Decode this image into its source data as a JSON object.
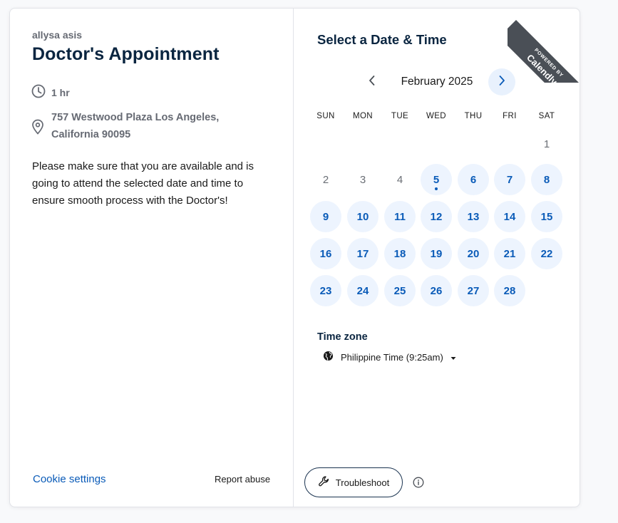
{
  "event": {
    "host": "allysa asis",
    "title": "Doctor's Appointment",
    "duration": "1 hr",
    "location_line1": "757 Westwood Plaza Los Angeles,",
    "location_line2": "California 90095",
    "description": "Please make sure that you are available and is going to attend the selected date and time to ensure smooth process with the Doctor's!",
    "cookie_settings": "Cookie settings",
    "report_abuse": "Report abuse"
  },
  "scheduler": {
    "title": "Select a Date & Time",
    "month_label": "February 2025",
    "weekdays": [
      "SUN",
      "MON",
      "TUE",
      "WED",
      "THU",
      "FRI",
      "SAT"
    ],
    "first_weekday_index": 6,
    "days_in_month": 28,
    "available_days": [
      5,
      6,
      7,
      8,
      9,
      10,
      11,
      12,
      13,
      14,
      15,
      16,
      17,
      18,
      19,
      20,
      21,
      22,
      23,
      24,
      25,
      26,
      27,
      28
    ],
    "today": 5
  },
  "timezone": {
    "label": "Time zone",
    "value": "Philippine Time (9:25am)"
  },
  "footer": {
    "troubleshoot": "Troubleshoot"
  },
  "ribbon": {
    "powered_by": "POWERED BY",
    "brand": "Calendly"
  },
  "colors": {
    "accent": "#0a5bb8",
    "available_bg": "#edf4fe",
    "heading": "#0a2540",
    "ribbon": "#4a4f56"
  }
}
